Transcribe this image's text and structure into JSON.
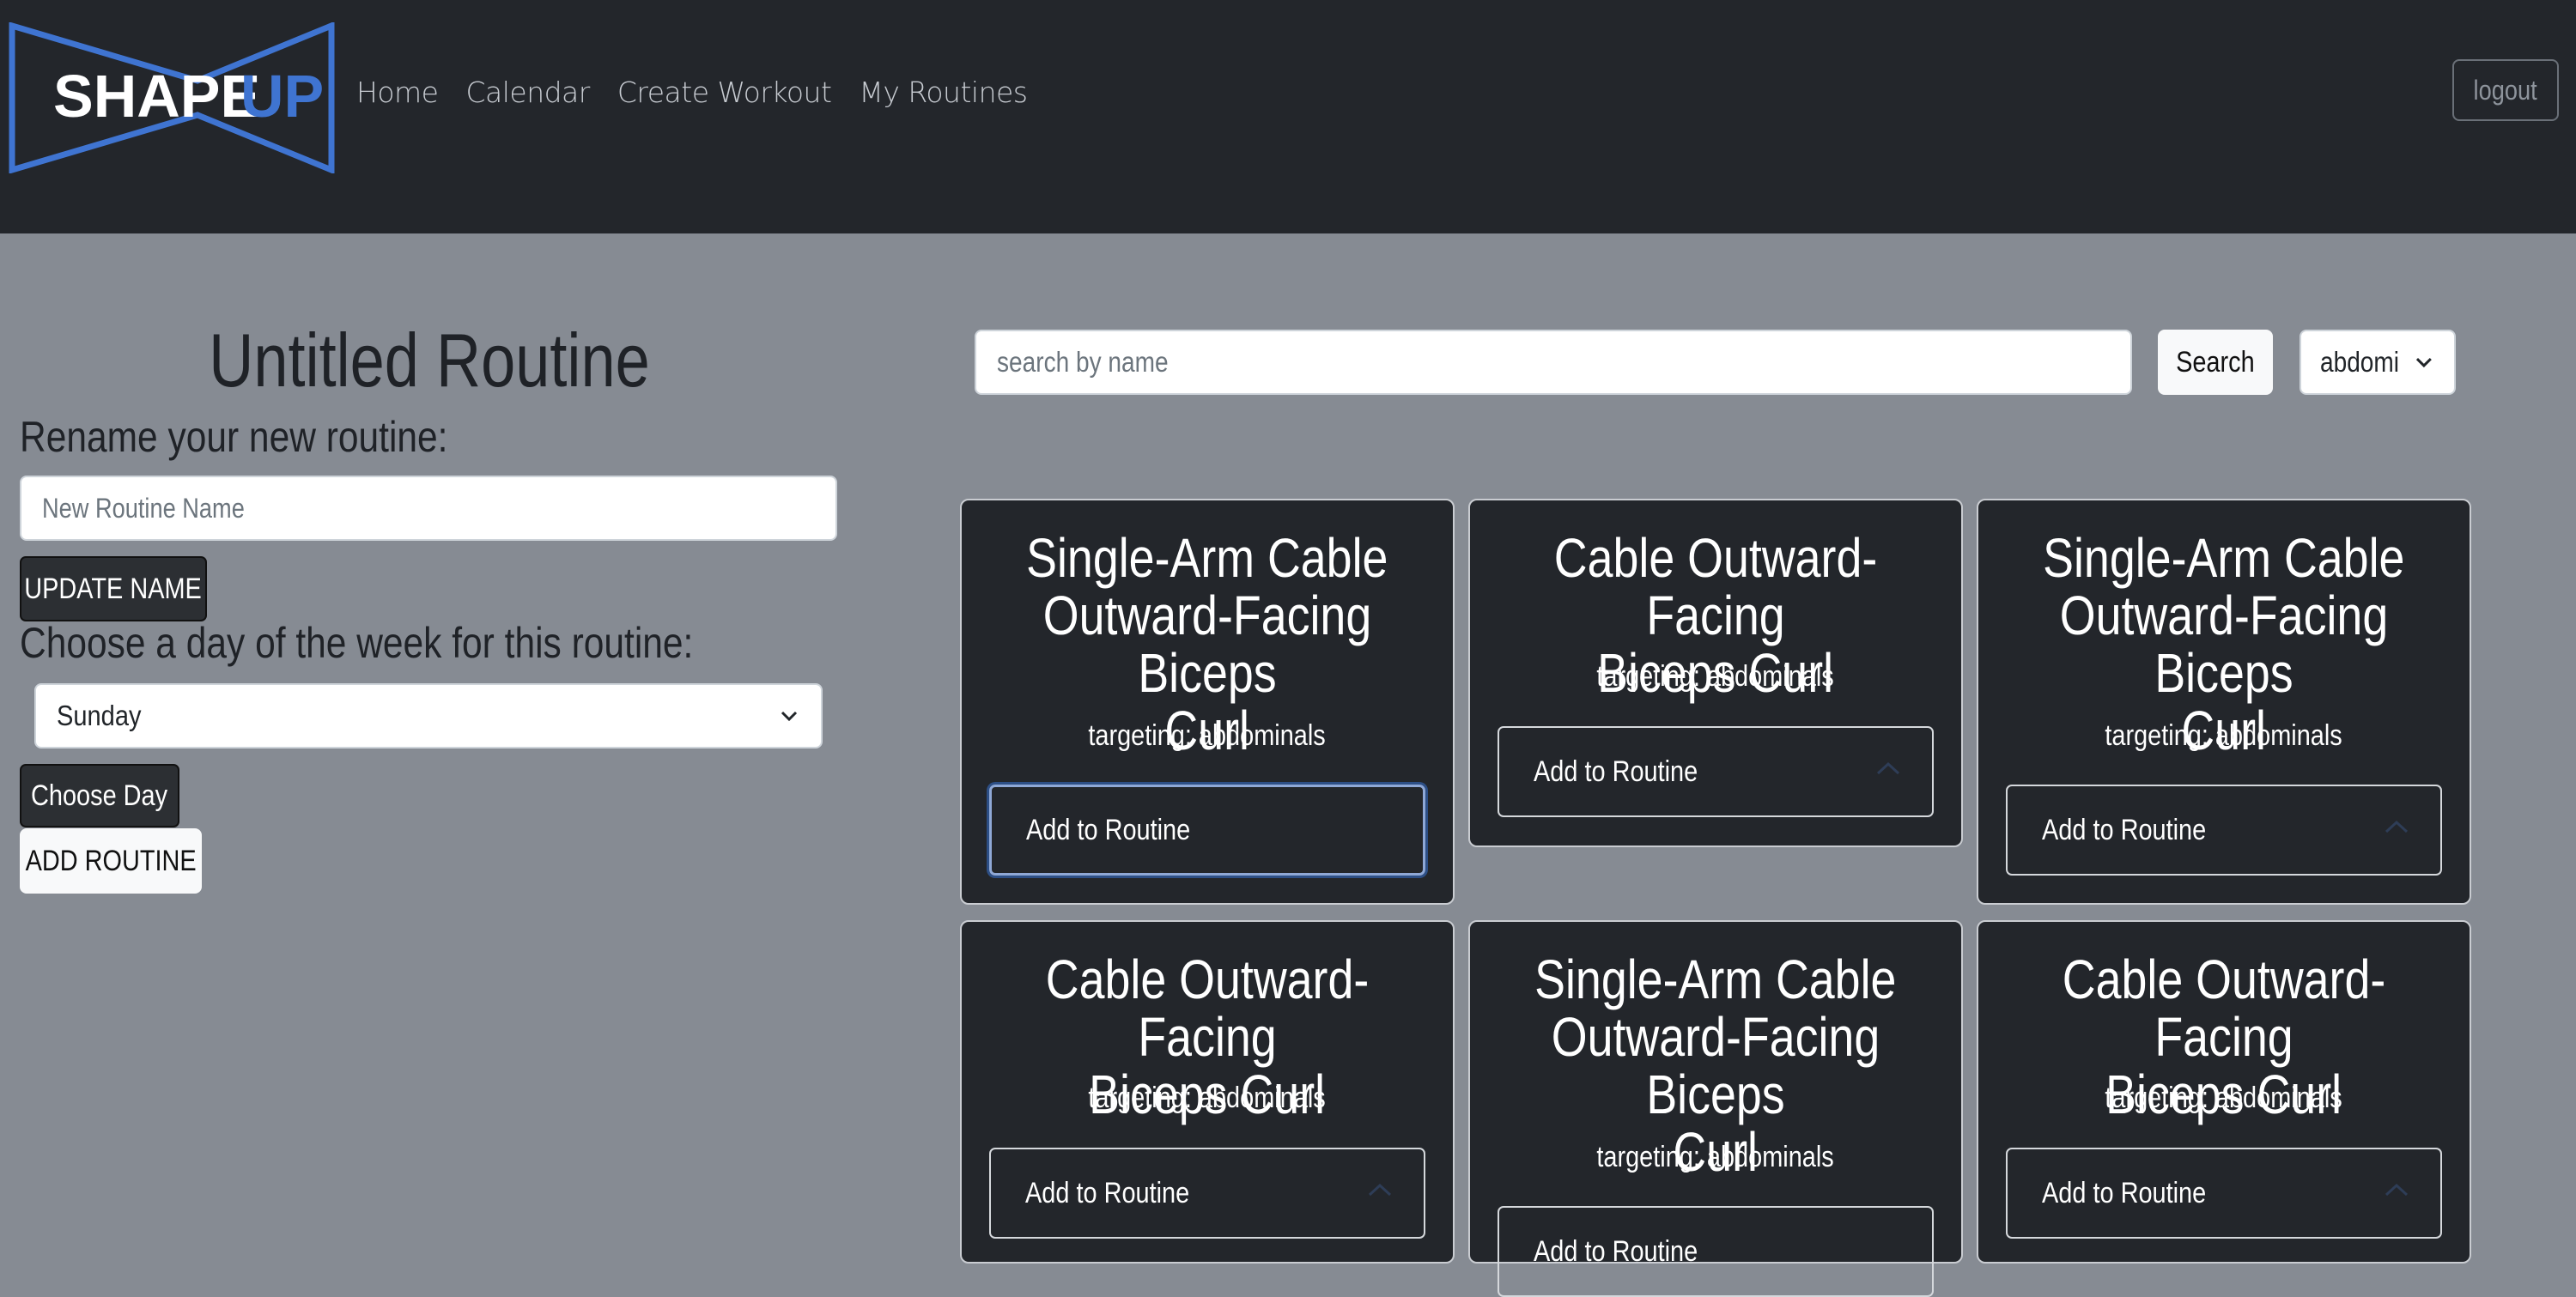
{
  "brand": {
    "logo_text_left": "SHAPE",
    "logo_text_right": "UP",
    "accent": "#3f74d1"
  },
  "nav": {
    "links": [
      "Home",
      "Calendar",
      "Create Workout",
      "My Routines"
    ],
    "logout_label": "logout"
  },
  "routine": {
    "title": "Untitled Routine",
    "rename_label": "Rename your new routine:",
    "name_placeholder": "New Routine Name",
    "update_button": "UPDATE NAME",
    "day_label": "Choose a day of the week for this routine:",
    "day_selected": "Sunday",
    "choose_day_button": "Choose Day",
    "add_routine_button": "ADD ROUTINE"
  },
  "search": {
    "placeholder": "search by name",
    "button": "Search",
    "filter_selected": "abdomi"
  },
  "exercises": [
    {
      "title_lines": [
        "Single-Arm Cable",
        "Outward-Facing Biceps",
        "Curl"
      ],
      "target": "targeting: abdominals",
      "button": "Add to Routine"
    },
    {
      "title_lines": [
        "Cable Outward-Facing",
        "Biceps Curl"
      ],
      "target": "targeting: abdominals",
      "button": "Add to Routine"
    },
    {
      "title_lines": [
        "Single-Arm Cable",
        "Outward-Facing Biceps",
        "Curl"
      ],
      "target": "targeting: abdominals",
      "button": "Add to Routine"
    },
    {
      "title_lines": [
        "Cable Outward-Facing",
        "Biceps Curl"
      ],
      "target": "targeting: abdominals",
      "button": "Add to Routine"
    },
    {
      "title_lines": [
        "Single-Arm Cable",
        "Outward-Facing Biceps",
        "Curl"
      ],
      "target": "targeting: abdominals",
      "button": "Add to Routine"
    },
    {
      "title_lines": [
        "Cable Outward-Facing",
        "Biceps Curl"
      ],
      "target": "targeting: abdominals",
      "button": "Add to Routine"
    }
  ]
}
